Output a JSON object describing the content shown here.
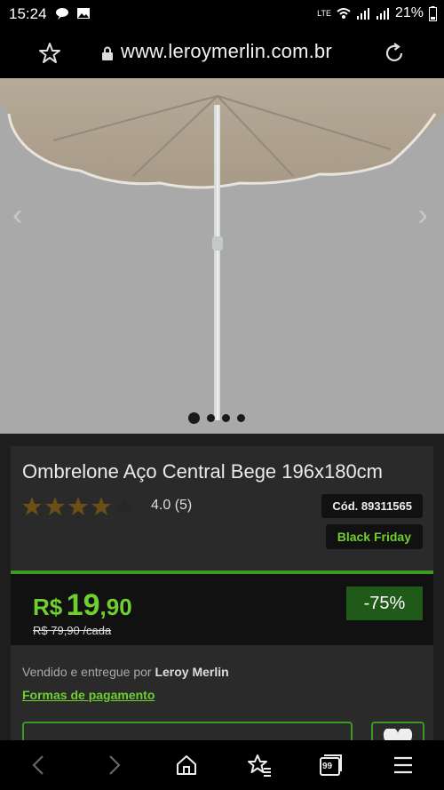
{
  "status_bar": {
    "time": "15:24",
    "battery": "21%",
    "network": "LTE"
  },
  "browser": {
    "url": "www.leroymerlin.com.br"
  },
  "gallery": {
    "prev": "‹",
    "next": "›",
    "slide_count": 4,
    "active_slide": 1
  },
  "product": {
    "title": "Ombrelone Aço Central Bege 196x180cm",
    "rating_value": 4.0,
    "rating_text": "4.0 (5)",
    "code": "Cód. 89311565",
    "badge": "Black Friday",
    "price_currency": "R$",
    "price_integer": "19",
    "price_cents": ",90",
    "old_price": "R$ 79,90 /cada",
    "discount": "-75%",
    "seller_prefix": "Vendido e entregue por",
    "seller_name": "Leroy Merlin",
    "payment_link": "Formas de pagamento"
  },
  "colors": {
    "accent": "#6fcf2f",
    "accent_dark": "#3a9a23",
    "star": "#6b4f16"
  },
  "icons": [
    "star-icon",
    "lock-icon",
    "reload-icon",
    "back-icon",
    "forward-icon",
    "home-icon",
    "bookmarks-icon",
    "tabs-icon",
    "menu-icon",
    "heart-icon"
  ],
  "bottom_nav": {
    "tabs_count": "99"
  }
}
